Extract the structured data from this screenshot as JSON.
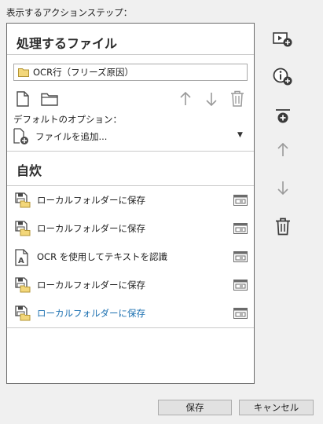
{
  "steps_label": "表示するアクションステップ：",
  "file_section": {
    "title": "処理するファイル",
    "selected_file": "OCR行（フリーズ原因）",
    "default_options_label": "デフォルトのオプション：",
    "add_file_label": "ファイルを追加..."
  },
  "action_section": {
    "title": "自炊",
    "items": [
      {
        "label": "ローカルフォルダーに保存",
        "icon": "save-to-folder-icon"
      },
      {
        "label": "ローカルフォルダーに保存",
        "icon": "save-to-folder-icon"
      },
      {
        "label": "OCR を使用してテキストを認識",
        "icon": "ocr-text-icon"
      },
      {
        "label": "ローカルフォルダーに保存",
        "icon": "save-to-folder-icon"
      },
      {
        "label": "ローカルフォルダーに保存",
        "icon": "save-to-folder-icon",
        "selected": true
      }
    ]
  },
  "buttons": {
    "save": "保存",
    "cancel": "キャンセル"
  },
  "colors": {
    "selected_text": "#1a6fb0",
    "icon_gray": "#9a9a9a",
    "icon_dark": "#4a4a4a"
  }
}
